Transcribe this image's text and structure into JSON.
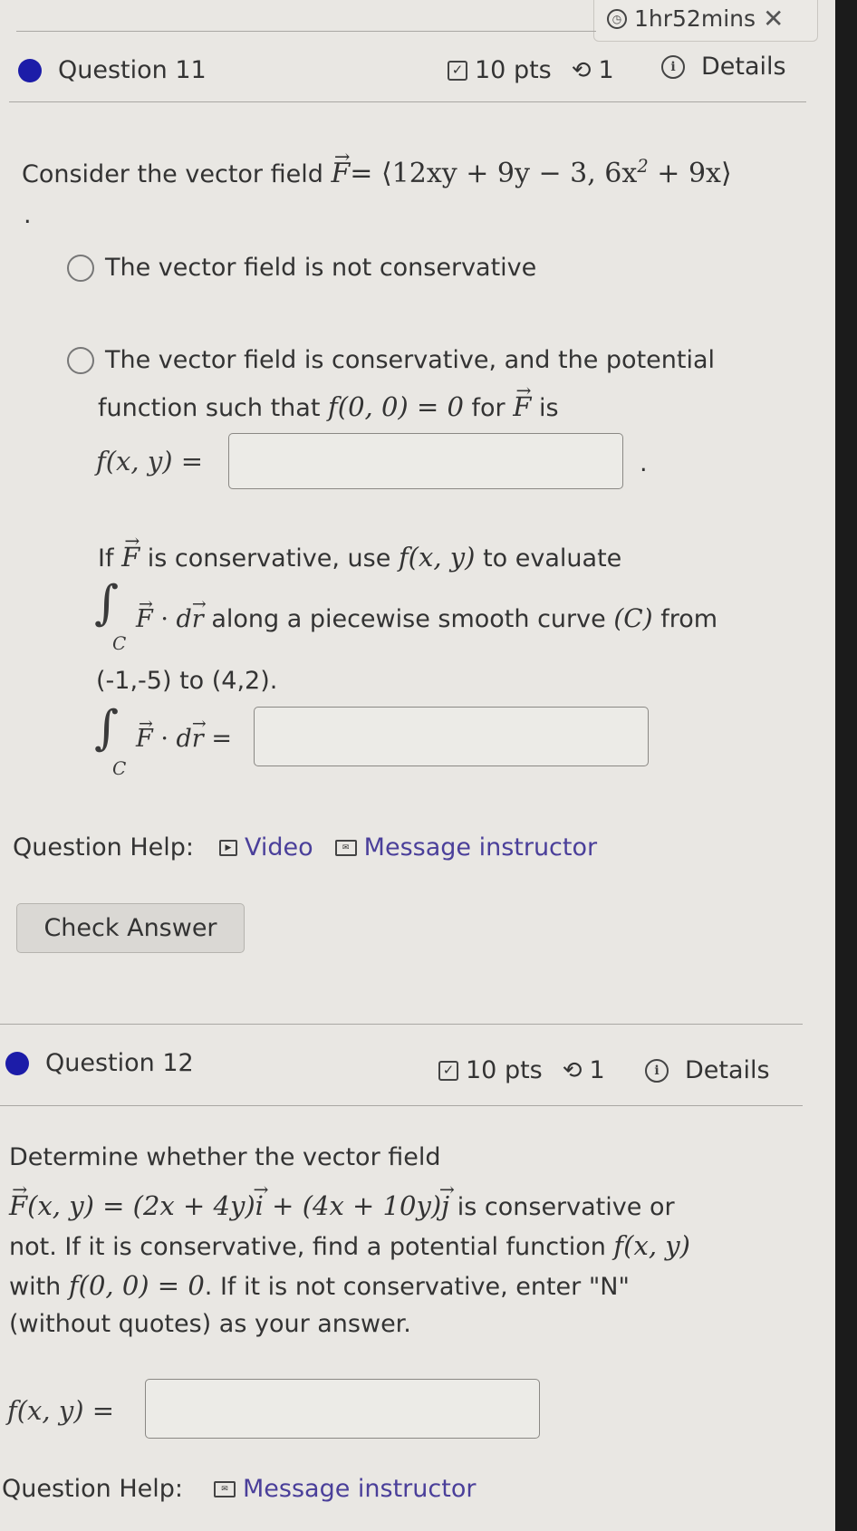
{
  "timer": {
    "label": "1hr52mins",
    "close_icon": "close-icon",
    "clock_icon": "clock-icon"
  },
  "questions": [
    {
      "title": "Question 11",
      "points": "10 pts",
      "attempts": "1",
      "details_label": "Details",
      "prompt_prefix": "Consider the vector field",
      "field_expr": "= ⟨12xy + 9y − 3, 6x",
      "field_exp": "2",
      "field_tail": " + 9x⟩",
      "trailing_period": ".",
      "options": [
        {
          "label": "The vector field is not conservative",
          "selected": false
        },
        {
          "label": "The vector field is conservative, and the potential",
          "selected": false
        }
      ],
      "option2_line2_prefix": "function such that",
      "option2_line2_math": "f(0, 0) = 0",
      "option2_line2_mid": "for",
      "option2_line2_suffix": "is",
      "fxy_label": "f(x, y) =",
      "fxy_value": "",
      "answer_period": ".",
      "eval_line1_prefix": "If",
      "eval_line1_mid": "is conservative, use",
      "eval_line1_math": "f(x, y)",
      "eval_line1_suffix": "to evaluate",
      "eval_line2_text": "along a piecewise smooth curve",
      "eval_line2_math": "(C)",
      "eval_line2_suffix": "from",
      "eval_line3": "(-1,-5) to (4,2).",
      "integral_value": "",
      "integral_sub": "C",
      "dot_dr": "· dr",
      "help_label": "Question Help:",
      "help_links": [
        "Video",
        "Message instructor"
      ],
      "check_answer_label": "Check Answer"
    },
    {
      "title": "Question 12",
      "points": "10 pts",
      "attempts": "1",
      "details_label": "Details",
      "line1": "Determine whether the vector field",
      "line2_math": "(x, y) = (2x + 4y)i + (4x + 10y)j",
      "line2_math_a": "(x, y) = (2x + 4y)",
      "line2_math_b": " + (4x + 10y)",
      "line2_suffix": "is conservative or",
      "line3_prefix": "not. If it is conservative, find a potential function",
      "line3_math": "f(x, y)",
      "line4_prefix": "with",
      "line4_math": "f(0, 0) = 0",
      "line4_suffix": ". If it is not conservative, enter \"N\"",
      "line5": "(without quotes) as your answer.",
      "fxy_label": "f(x, y) =",
      "fxy_value": "",
      "help_label": "Question Help:",
      "help_links": [
        "Message instructor"
      ]
    }
  ],
  "colors": {
    "bullet": "#1c1ca8",
    "link": "#4a3f9a",
    "background": "#e9e7e3"
  }
}
